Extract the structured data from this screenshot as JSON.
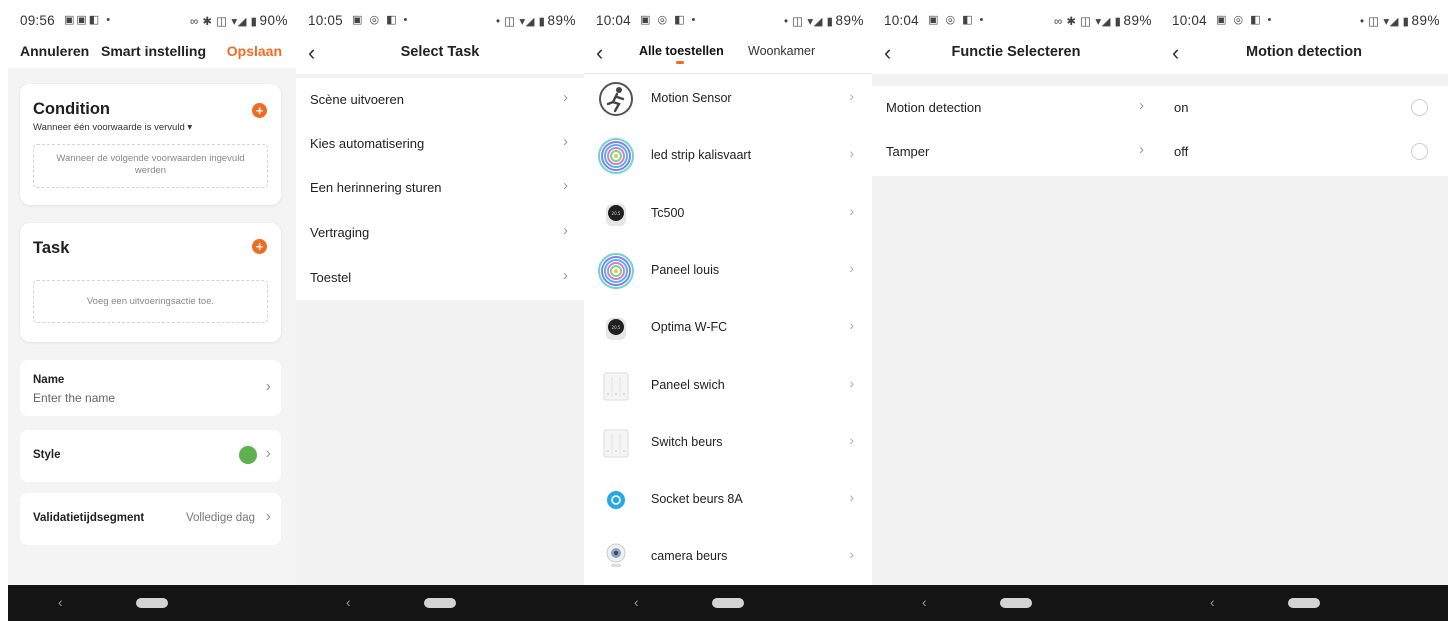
{
  "screens": [
    {
      "status": {
        "time": "09:56",
        "battery": "90%"
      },
      "header": {
        "cancel": "Annuleren",
        "title": "Smart instelling",
        "save": "Opslaan"
      },
      "condition": {
        "title": "Condition",
        "subtitle": "Wanneer één voorwaarde is vervuld ▾",
        "placeholder": "Wanneer de volgende voorwaarden ingevuld werden"
      },
      "task": {
        "title": "Task",
        "placeholder": "Voeg een uitvoeringsactie toe."
      },
      "name": {
        "label": "Name",
        "placeholder": "Enter the name"
      },
      "style": {
        "label": "Style",
        "color": "#5fb04e"
      },
      "validity": {
        "label": "Validatietijdsegment",
        "value": "Volledige dag"
      }
    },
    {
      "status": {
        "time": "10:05",
        "battery": "89%"
      },
      "title": "Select Task",
      "items": [
        "Scène uitvoeren",
        "Kies automatisering",
        "Een herinnering sturen",
        "Vertraging",
        "Toestel"
      ]
    },
    {
      "status": {
        "time": "10:04",
        "battery": "89%"
      },
      "tabs": [
        "Alle toestellen",
        "Woonkamer"
      ],
      "devices": [
        {
          "name": "Motion Sensor",
          "icon": "motion-sensor-icon"
        },
        {
          "name": "led strip kalisvaart",
          "icon": "rgb-ring-icon"
        },
        {
          "name": "Tc500",
          "icon": "thermostat-icon"
        },
        {
          "name": "Paneel louis",
          "icon": "rgb-ring-icon"
        },
        {
          "name": "Optima W-FC",
          "icon": "thermostat-icon"
        },
        {
          "name": "Paneel swich",
          "icon": "wall-switch-icon"
        },
        {
          "name": "Switch beurs",
          "icon": "wall-switch-icon"
        },
        {
          "name": "Socket beurs 8A",
          "icon": "socket-icon"
        },
        {
          "name": "camera beurs",
          "icon": "camera-icon"
        }
      ]
    },
    {
      "status": {
        "time": "10:04",
        "battery": "89%"
      },
      "title": "Functie Selecteren",
      "items": [
        "Motion detection",
        "Tamper"
      ]
    },
    {
      "status": {
        "time": "10:04",
        "battery": "89%"
      },
      "title": "Motion detection",
      "options": [
        "on",
        "off"
      ]
    }
  ],
  "colors": {
    "accent": "#f26b22",
    "navbar": "#141414"
  }
}
